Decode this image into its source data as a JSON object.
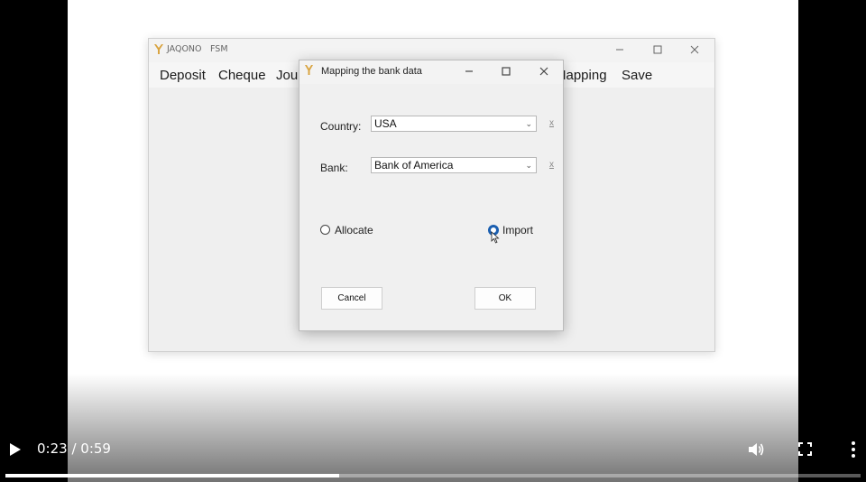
{
  "app": {
    "title_parts": [
      "JAQONO",
      "FSM"
    ],
    "menu": [
      "Deposit",
      "Cheque",
      "Jour",
      "Mapping",
      "Save"
    ]
  },
  "dialog": {
    "title": "Mapping the bank data",
    "country": {
      "label": "Country:",
      "value": "USA",
      "clear": "x"
    },
    "bank": {
      "label": "Bank:",
      "value": "Bank of America",
      "clear": "x"
    },
    "options": [
      {
        "label": "Allocate",
        "checked": false
      },
      {
        "label": "Import",
        "checked": true
      }
    ],
    "buttons": {
      "cancel": "Cancel",
      "ok": "OK"
    }
  },
  "player": {
    "time": "0:23 / 0:59",
    "progress_fraction": 0.39
  },
  "colors": {
    "accent": "#1b5fb0",
    "logo": "#d9a441"
  }
}
